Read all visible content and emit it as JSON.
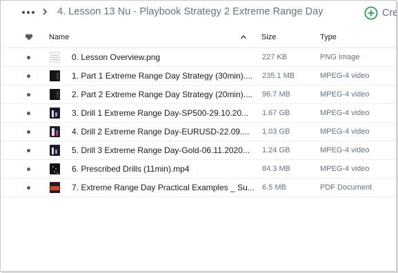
{
  "breadcrumb": {
    "title": "4. Lesson 13 Nu - Playbook Strategy 2 Extreme Range Day",
    "create_label": "Cre",
    "more_icon": "more-horizontal-icon",
    "separator_icon": "chevron-right-icon",
    "create_icon": "plus-circle-icon",
    "accent_color": "#2a9d52"
  },
  "header": {
    "favorite_icon": "heart-icon",
    "name": "Name",
    "sort_icon": "sort-ascending-icon",
    "size": "Size",
    "type": "Type"
  },
  "files": [
    {
      "name": "0. Lesson Overview.png",
      "size": "227 KB",
      "type": "PNG Image",
      "thumb": "png"
    },
    {
      "name": "1. Part 1 Extreme Range Day Strategy (30min)....",
      "size": "235.1 MB",
      "type": "MPEG-4 video",
      "thumb": "vid-dark"
    },
    {
      "name": "2. Part 2 Extreme Range Day Strategy (20min)....",
      "size": "96.7 MB",
      "type": "MPEG-4 video",
      "thumb": "vid-dark"
    },
    {
      "name": "3. Drill 1 Extreme Range Day-SP500-29.10.20...",
      "size": "1.67 GB",
      "type": "MPEG-4 video",
      "thumb": "chart"
    },
    {
      "name": "4. Drill 2 Extreme Range Day-EURUSD-22.09....",
      "size": "1.03 GB",
      "type": "MPEG-4 video",
      "thumb": "chart2"
    },
    {
      "name": "5. Drill 3 Extreme Range Day-Gold-06.11.2020...",
      "size": "1.24 GB",
      "type": "MPEG-4 video",
      "thumb": "chart"
    },
    {
      "name": "6. Prescribed Drills (11min).mp4",
      "size": "84.3 MB",
      "type": "MPEG-4 video",
      "thumb": "dots"
    },
    {
      "name": "7. Extreme Range Day Practical Examples _ Su...",
      "size": "6.5 MB",
      "type": "PDF Document",
      "thumb": "pdf"
    }
  ]
}
